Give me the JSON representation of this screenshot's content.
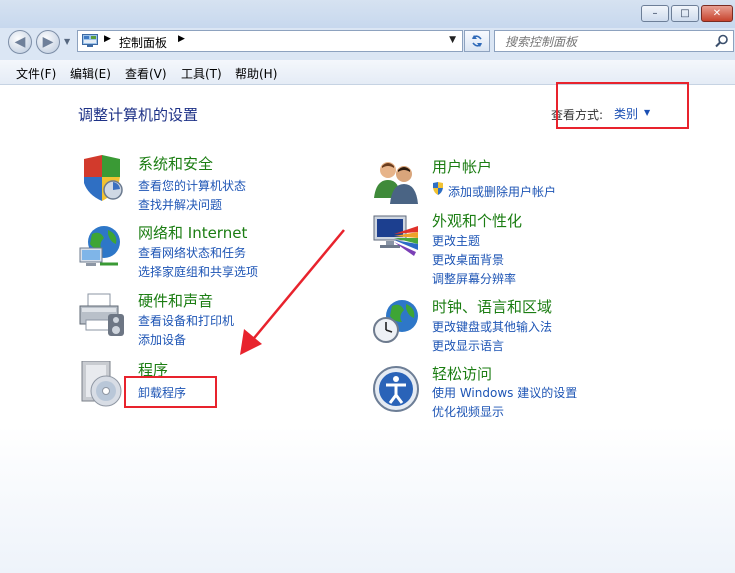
{
  "window": {
    "minimize_glyph": "–",
    "maximize_glyph": "□",
    "close_glyph": "✕"
  },
  "address": {
    "path": "控制面板",
    "search_placeholder": "搜索控制面板"
  },
  "menu": [
    "文件(F)",
    "编辑(E)",
    "查看(V)",
    "工具(T)",
    "帮助(H)"
  ],
  "page": {
    "title": "调整计算机的设置",
    "viewby_label": "查看方式:",
    "viewby_value": "类别"
  },
  "categories": [
    {
      "id": "system-security",
      "icon": "shield-icon",
      "title": "系统和安全",
      "links": [
        "查看您的计算机状态",
        "查找并解决问题"
      ]
    },
    {
      "id": "network-internet",
      "icon": "globe-network-icon",
      "title": "网络和 Internet",
      "links": [
        "查看网络状态和任务",
        "选择家庭组和共享选项"
      ]
    },
    {
      "id": "hardware-sound",
      "icon": "printer-icon",
      "title": "硬件和声音",
      "links": [
        "查看设备和打印机",
        "添加设备"
      ]
    },
    {
      "id": "programs",
      "icon": "programs-disc-icon",
      "title": "程序",
      "links": [
        "卸载程序"
      ]
    },
    {
      "id": "user-accounts",
      "icon": "users-icon",
      "title": "用户帐户",
      "links": [
        "添加或删除用户帐户"
      ]
    },
    {
      "id": "appearance",
      "icon": "monitor-palette-icon",
      "title": "外观和个性化",
      "links": [
        "更改主题",
        "更改桌面背景",
        "调整屏幕分辨率"
      ]
    },
    {
      "id": "clock-region",
      "icon": "clock-globe-icon",
      "title": "时钟、语言和区域",
      "links": [
        "更改键盘或其他输入法",
        "更改显示语言"
      ]
    },
    {
      "id": "ease-of-access",
      "icon": "ease-of-access-icon",
      "title": "轻松访问",
      "links": [
        "使用 Windows 建议的设置",
        "优化视频显示"
      ]
    }
  ],
  "colors": {
    "highlight": "#e8232d",
    "category_title": "#1b7d12",
    "link": "#1e55b5"
  }
}
